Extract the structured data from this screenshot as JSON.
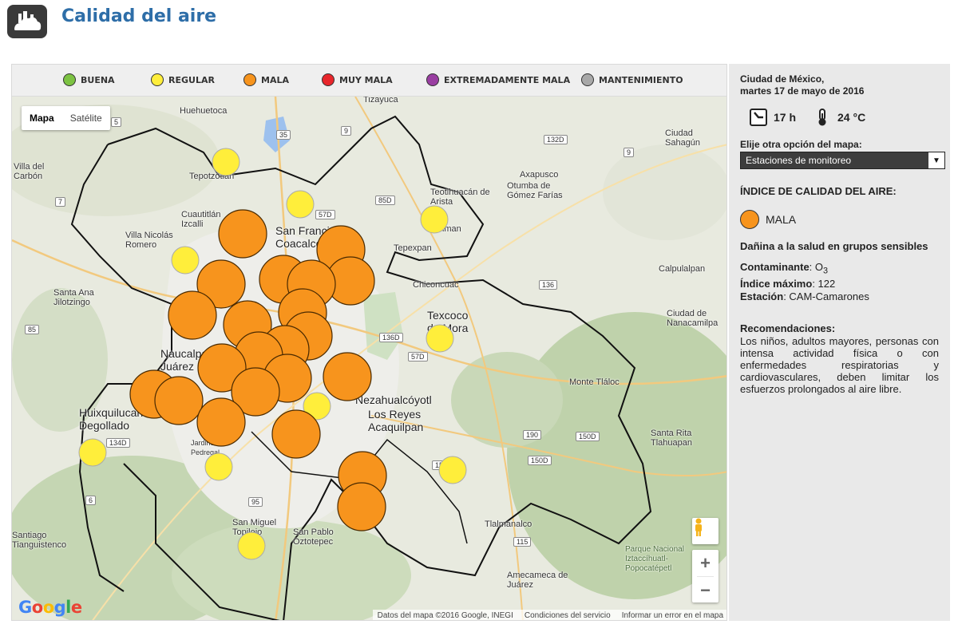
{
  "header": {
    "title": "Calidad del aire",
    "logo_icon": "cloud-city-icon"
  },
  "legend": [
    {
      "label": "BUENA",
      "color": "#7cc242"
    },
    {
      "label": "REGULAR",
      "color": "#ffee3b"
    },
    {
      "label": "MALA",
      "color": "#f7941d"
    },
    {
      "label": "MUY MALA",
      "color": "#e8262b"
    },
    {
      "label": "EXTREMADAMENTE MALA",
      "color": "#9a3ea2"
    },
    {
      "label": "MANTENIMIENTO",
      "color": "#a8a8a8"
    }
  ],
  "map": {
    "type_buttons": [
      "Mapa",
      "Satélite"
    ],
    "active_type": "Mapa",
    "attribution": [
      "Datos del mapa ©2016 Google, INEGI",
      "Condiciones del servicio",
      "Informar un error en el mapa"
    ],
    "google_logo": "Google",
    "zoom_in": "+",
    "zoom_out": "−",
    "place_labels": [
      "Huehuetoca",
      "Villa del Carbón",
      "Tepotzotlán",
      "Cuautitlán Izcalli",
      "Villa Nicolás Romero",
      "San Francisco Coacalco",
      "Santa Ana Jilotzingo",
      "Naucalpan de Juárez",
      "Huixquilucan de Degollado",
      "Teotihuacán de Arista",
      "Axapusco",
      "Otumba de Gómez Farías",
      "Ciudad Sahagún",
      "Acolman",
      "Tepexpan",
      "Chiconcuac",
      "Texcoco de Mora",
      "Calpulalpan",
      "Ciudad de Nanacamilpa",
      "Nezahualcóyotl",
      "Los Reyes Acaquilpan",
      "Monte Tláloc",
      "Santa Rita Tlahuapan",
      "Jardines del Pedregal",
      "San Miguel Topilejo",
      "San Pablo Oztotepec",
      "Tlalmanalco",
      "Amecameca de Juárez",
      "Santiago Tianguistenco",
      "Parque Nacional Iztaccíhuatl-Popocatépetl",
      "Tizayuca"
    ],
    "road_badges": [
      "35",
      "9",
      "132D",
      "57D",
      "85D",
      "136",
      "136D",
      "57D",
      "134D",
      "150D",
      "190",
      "150D",
      "150D",
      "95",
      "115",
      "5",
      "85",
      "6",
      "9",
      "7"
    ],
    "stations": [
      {
        "status": "REGULAR",
        "size": "small"
      },
      {
        "status": "REGULAR",
        "size": "small"
      },
      {
        "status": "REGULAR",
        "size": "small"
      },
      {
        "status": "REGULAR",
        "size": "small"
      },
      {
        "status": "REGULAR",
        "size": "small"
      },
      {
        "status": "REGULAR",
        "size": "small"
      },
      {
        "status": "REGULAR",
        "size": "small"
      },
      {
        "status": "REGULAR",
        "size": "small"
      },
      {
        "status": "REGULAR",
        "size": "small"
      },
      {
        "status": "REGULAR",
        "size": "small"
      },
      {
        "status": "MALA",
        "size": "large"
      },
      {
        "status": "MALA",
        "size": "large"
      },
      {
        "status": "MALA",
        "size": "large"
      },
      {
        "status": "MALA",
        "size": "large"
      },
      {
        "status": "MALA",
        "size": "large"
      },
      {
        "status": "MALA",
        "size": "large"
      },
      {
        "status": "MALA",
        "size": "large"
      },
      {
        "status": "MALA",
        "size": "large"
      },
      {
        "status": "MALA",
        "size": "large"
      },
      {
        "status": "MALA",
        "size": "large"
      },
      {
        "status": "MALA",
        "size": "large"
      },
      {
        "status": "MALA",
        "size": "large"
      },
      {
        "status": "MALA",
        "size": "large"
      },
      {
        "status": "MALA",
        "size": "large"
      },
      {
        "status": "MALA",
        "size": "large"
      },
      {
        "status": "MALA",
        "size": "large"
      },
      {
        "status": "MALA",
        "size": "large"
      },
      {
        "status": "MALA",
        "size": "large"
      },
      {
        "status": "MALA",
        "size": "large"
      },
      {
        "status": "MALA",
        "size": "large"
      },
      {
        "status": "MALA",
        "size": "large"
      },
      {
        "status": "MALA",
        "size": "large"
      }
    ]
  },
  "side": {
    "location": "Ciudad de México,",
    "date": "martes 17 de mayo de 2016",
    "hour": "17 h",
    "temperature": "24 °C",
    "map_option_label": "Elije otra opción del mapa:",
    "map_option_value": "Estaciones de monitoreo",
    "aqi_heading": "ÍNDICE DE CALIDAD DEL AIRE:",
    "aqi_status": "MALA",
    "aqi_status_color": "#f7941d",
    "aqi_description": "Dañina a la salud en grupos sensibles",
    "pollutant_label": "Contaminante",
    "pollutant_value": "O",
    "pollutant_sub": "3",
    "max_index_label": "Índice máximo",
    "max_index_value": "122",
    "station_label": "Estación",
    "station_value": "CAM-Camarones",
    "reco_heading": "Recomendaciones:",
    "reco_text": "Los niños, adultos mayores, personas con intensa actividad física o con enfermedades respiratorias y cardiovasculares, deben limitar los esfuerzos prolongados al aire libre."
  }
}
